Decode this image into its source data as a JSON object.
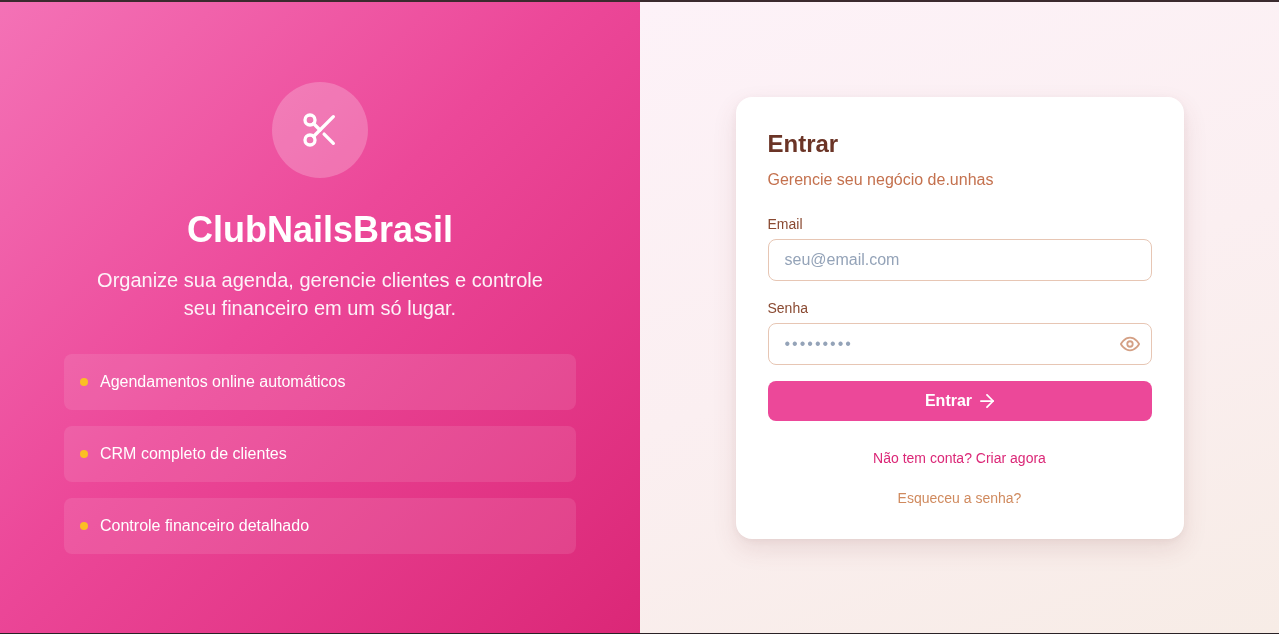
{
  "brand": {
    "name": "ClubNailsBrasil",
    "tagline": "Organize sua agenda, gerencie clientes e controle seu financeiro em um só lugar."
  },
  "features": [
    {
      "label": "Agendamentos online automáticos"
    },
    {
      "label": "CRM completo de clientes"
    },
    {
      "label": "Controle financeiro detalhado"
    }
  ],
  "login": {
    "title": "Entrar",
    "subtitle": "Gerencie seu negócio de.unhas",
    "fields": [
      {
        "kind": "email",
        "label": "Email",
        "placeholder": "seu@email.com"
      },
      {
        "kind": "password",
        "label": "Senha",
        "placeholder": "•••••••••"
      }
    ],
    "submit": "Entrar",
    "signup_link": "Não tem conta? Criar agora",
    "forgot_link": "Esqueceu a senha?"
  }
}
